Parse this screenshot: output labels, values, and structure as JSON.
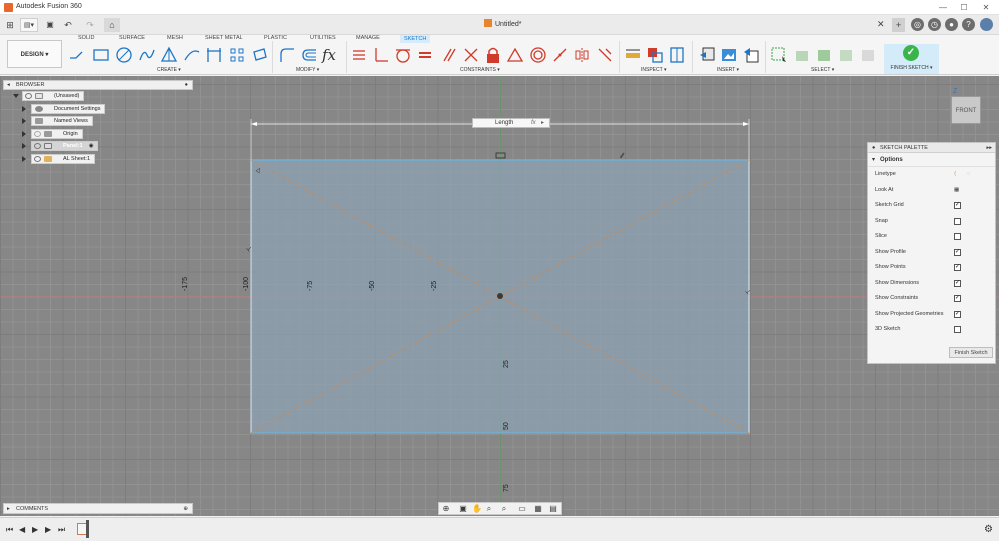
{
  "titlebar": {
    "app_title": "Autodesk Fusion 360",
    "minimize": "—",
    "maximize": "☐",
    "close": "✕"
  },
  "qab": {
    "grid_menu": "⊞",
    "save": "💾",
    "undo": "↶",
    "redo": "↷",
    "home": "⌂",
    "doc_title": "Untitled*",
    "doc_close": "✕",
    "new_tab": "+"
  },
  "ribbon": {
    "design_label": "DESIGN ▾",
    "tabs": [
      {
        "label": "SOLID"
      },
      {
        "label": "SURFACE"
      },
      {
        "label": "MESH"
      },
      {
        "label": "SHEET METAL"
      },
      {
        "label": "PLASTIC"
      },
      {
        "label": "UTILITIES"
      },
      {
        "label": "MANAGE"
      },
      {
        "label": "SKETCH"
      }
    ],
    "groups": {
      "create": "CREATE ▾",
      "modify": "MODIFY ▾",
      "constraints": "CONSTRAINTS ▾",
      "inspect": "INSPECT ▾",
      "insert": "INSERT ▾",
      "select": "SELECT ▾"
    },
    "finish_sketch": "FINISH SKETCH ▾",
    "accent": "#0f7ad1"
  },
  "browser": {
    "header": "BROWSER",
    "items": [
      {
        "label": "(Unsaved)"
      },
      {
        "label": "Document Settings"
      },
      {
        "label": "Named Views"
      },
      {
        "label": "Origin"
      },
      {
        "label": "Panel:1"
      },
      {
        "label": "AL Sheet:1"
      }
    ]
  },
  "sketch": {
    "dimension_label": "Length",
    "dimension_fx": "fx",
    "ruler_labels": [
      "-175",
      "-100",
      "-75",
      "-50",
      "-25",
      "25",
      "50",
      "75"
    ]
  },
  "palette": {
    "header": "SKETCH PALETTE",
    "options_label": "Options",
    "rows": [
      {
        "label": "Linetype",
        "checked": null
      },
      {
        "label": "Look At",
        "checked": null
      },
      {
        "label": "Sketch Grid",
        "checked": true
      },
      {
        "label": "Snap",
        "checked": false
      },
      {
        "label": "Slice",
        "checked": false
      },
      {
        "label": "Show Profile",
        "checked": true
      },
      {
        "label": "Show Points",
        "checked": true
      },
      {
        "label": "Show Dimensions",
        "checked": true
      },
      {
        "label": "Show Constraints",
        "checked": true
      },
      {
        "label": "Show Projected Geometries",
        "checked": true
      },
      {
        "label": "3D Sketch",
        "checked": false
      }
    ],
    "finish_button": "Finish Sketch"
  },
  "viewcube": {
    "face": "FRONT",
    "axis": "Z"
  },
  "comments": {
    "header": "COMMENTS"
  },
  "timeline": {
    "first": "⏮",
    "prev": "◀",
    "play": "▶",
    "next": "▶",
    "last": "⏭",
    "settings": "⚙"
  }
}
